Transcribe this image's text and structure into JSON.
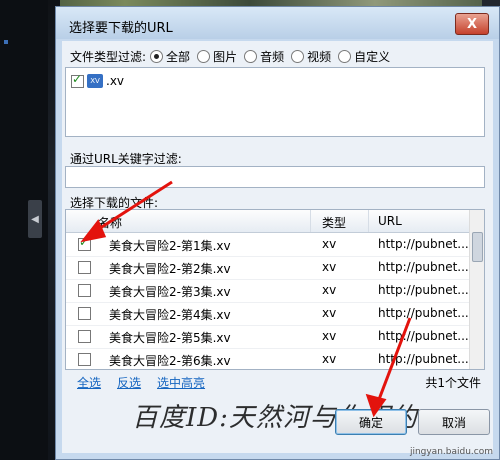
{
  "dialog": {
    "title": "选择要下载的URL",
    "close_label": "X"
  },
  "type_filter": {
    "label": "文件类型过滤:",
    "options": [
      "全部",
      "图片",
      "音频",
      "视频",
      "自定义"
    ],
    "selected": "全部",
    "types": [
      {
        "label": ".xv",
        "checked": true,
        "icon": "xv-file-icon"
      }
    ]
  },
  "url_filter": {
    "label": "通过URL关键字过滤:",
    "value": ""
  },
  "file_list": {
    "label": "选择下载的文件:",
    "columns": [
      "名称",
      "类型",
      "URL"
    ],
    "rows": [
      {
        "checked": true,
        "name": "美食大冒险2-第1集.xv",
        "type": "xv",
        "url": "http://pubnet..."
      },
      {
        "checked": false,
        "name": "美食大冒险2-第2集.xv",
        "type": "xv",
        "url": "http://pubnet..."
      },
      {
        "checked": false,
        "name": "美食大冒险2-第3集.xv",
        "type": "xv",
        "url": "http://pubnet..."
      },
      {
        "checked": false,
        "name": "美食大冒险2-第4集.xv",
        "type": "xv",
        "url": "http://pubnet..."
      },
      {
        "checked": false,
        "name": "美食大冒险2-第5集.xv",
        "type": "xv",
        "url": "http://pubnet..."
      },
      {
        "checked": false,
        "name": "美食大冒险2-第6集.xv",
        "type": "xv",
        "url": "http://pubnet..."
      }
    ]
  },
  "selection_links": {
    "all": "全选",
    "invert": "反选",
    "highlight": "选中高亮"
  },
  "file_count": "共1个文件",
  "buttons": {
    "ok": "确定",
    "cancel": "取消"
  },
  "watermark": "百度ID:天然河与你相约",
  "site_mark": "jingyan.baidu.com",
  "colors": {
    "accent": "#1565c0",
    "annotation": "#e3130d"
  }
}
